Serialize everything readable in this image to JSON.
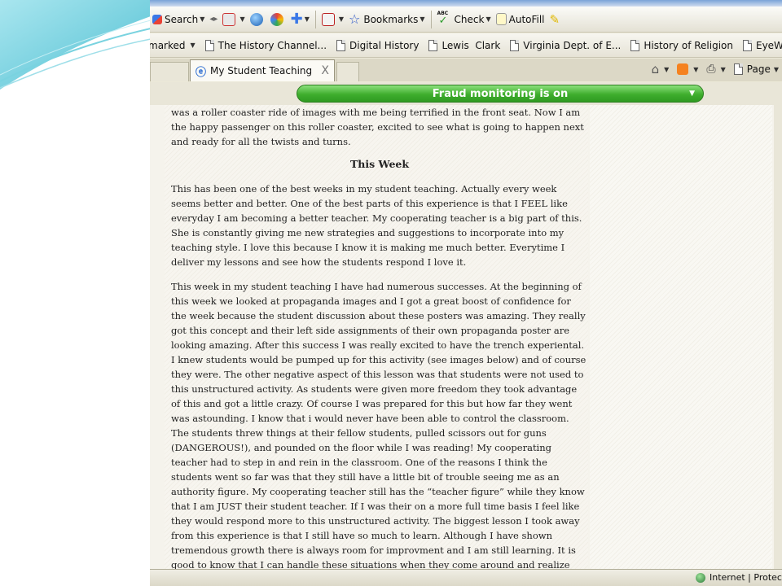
{
  "toolbar": {
    "search_label": "Search",
    "bookmarks_label": "Bookmarks",
    "check_label": "Check",
    "autofill_label": "AutoFill",
    "check_badge": "ABC"
  },
  "bookmarks_bar": {
    "items": [
      "marked",
      "The History Channel...",
      "Digital History",
      "Lewis  Clark",
      "Virginia Dept. of E...",
      "History of Religion",
      "EyeWitness to Hi"
    ]
  },
  "tabs": {
    "active_title": "My Student Teaching",
    "close_glyph": "X"
  },
  "command_bar": {
    "page_label": "Page"
  },
  "security_bar": {
    "text": "Fraud monitoring is on"
  },
  "post": {
    "intro_lines": [
      "was a roller coaster ride of images with me being terrified in the front seat.  Now I am",
      "the happy passenger on this roller coaster, excited to see what is going to happen next",
      "and ready for all the twists and turns."
    ],
    "heading": "This Week",
    "paragraph1": "This has been one of the best weeks in my student teaching.  Actually every week seems better and better.  One of the best parts of this experience is that I FEEL like everyday I am becoming a better teacher.  My cooperating teacher is a big part of this.  She is constantly giving me new strategies and suggestions to incorporate into my teaching style.  I love this because I know it is making me much better.  Everytime I deliver my lessons and see how the students respond I love it.",
    "paragraph2": "This week in my student teaching I have had numerous successes.  At the beginning of this week we looked at propaganda images and I got a great boost of confidence for the week because the student discussion about these posters was amazing.  They really got this concept and their left side assignments of their own propaganda poster are looking amazing.  After this success I was really excited to have the trench experiental.   I knew students would be pumped up for this activity (see images below) and of course they were.  The other negative aspect of this lesson was that students were not used to this unstructured activity.  As students were given more freedom they took advantage of this and got a little crazy.  Of course I was prepared for this but how far they went was astounding.  I know that i would never have been able to control the classroom.  The students threw things at their fellow students, pulled scissors out for guns (DANGEROUS!), and pounded on the floor while I was reading!  My cooperating teacher had to step in and rein in the classroom.  One of the reasons I think the students went so far was that they still have a little bit of trouble seeing me as an authority figure.  My cooperating teacher still has the “teacher figure”  while they know that I am JUST their student teacher.  If I was their on a more full time basis I feel like they would respond more to this unstructured activity.  The biggest lesson I took away from this experience is that I still have so much to learn.  Although I have shown tremendous growth there is always room for improvment and I am still learning.  It is good to know that I can handle these situations when they come around and realize that I dont’ have to be"
  },
  "status_bar": {
    "zone_text": "Internet | Protec"
  },
  "colors": {
    "security_green": "#3fae2d",
    "chrome_beige": "#ece9d8",
    "slide_teal": "#5fc8d8"
  }
}
